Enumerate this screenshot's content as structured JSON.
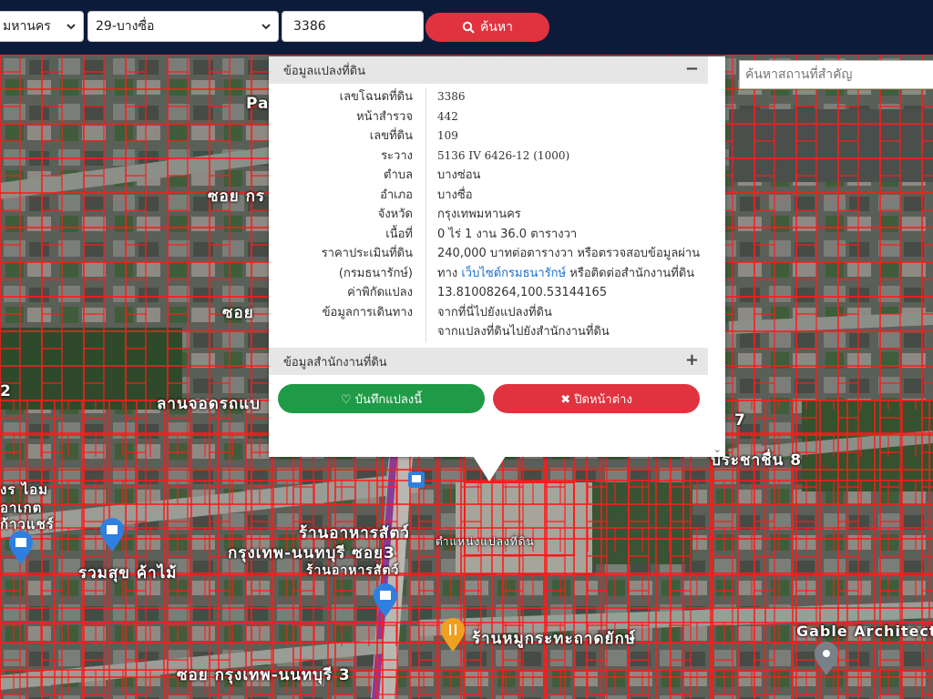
{
  "search": {
    "province_value": "มหานคร",
    "district_value": "29-บางซื่อ",
    "deed_value": "3386",
    "search_label": "ค้นหา"
  },
  "map": {
    "place_search_placeholder": "ค้นหาสถานที่สำคัญ",
    "labels": {
      "pa": "Pa",
      "soi_top": "ซอย กร",
      "soi_mid": "ซอย",
      "num2": "2",
      "lan_jod": "ลานจอดรถแบ",
      "num7": "7",
      "pracha_8": "ประชาชื่น 8",
      "left_text": "งร ไอม",
      "left_text2": "อาเกต",
      "left_text3": "ก้าวแชร์",
      "ruam_suk": "รวมสุข ค้าไม้",
      "restaurant": "ร้านอาหารสัตว์",
      "bkk_non_soi3": "กรุงเทพ-นนทบุรี ซอย3",
      "restaurant2": "ร้านอาหารสัตว์",
      "parcel_pos": "ตำแหน่งแปลงที่ดิน",
      "moo_kratha": "ร้านหมูกระทะถาดยักษ์",
      "gable": "Gable Architect",
      "soi_bottom": "ซอย กรุงเทพ-นนทบุรี 3"
    }
  },
  "popup": {
    "section1_title": "ข้อมูลแปลงที่ดิน",
    "section1_toggle": "−",
    "rows": [
      {
        "k": "เลขโฉนดที่ดิน",
        "v": "3386"
      },
      {
        "k": "หน้าสำรวจ",
        "v": "442"
      },
      {
        "k": "เลขที่ดิน",
        "v": "109"
      },
      {
        "k": "ระวาง",
        "v": "5136 IV 6426-12 (1000)"
      },
      {
        "k": "ตำบล",
        "v": "บางซ่อน"
      },
      {
        "k": "อำเภอ",
        "v": "บางซื่อ"
      },
      {
        "k": "จังหวัด",
        "v": "กรุงเทพมหานคร"
      },
      {
        "k": "เนื้อที่",
        "v": "0 ไร่ 1 งาน 36.0 ตารางวา"
      },
      {
        "k": "ราคาประเมินที่ดิน",
        "v": "240,000 บาทต่อตารางวา หรือตรวจสอบข้อมูลผ่าน"
      }
    ],
    "dept_key": "(กรมธนารักษ์)",
    "dept_v1": "ทาง",
    "dept_link": "เว็บไซต์กรมธนารักษ์",
    "dept_v2": "หรือติดต่อสำนักงานที่ดิน",
    "coord_key": "ค่าพิกัดแปลง",
    "coord_value": "13.81008264,100.53144165",
    "travel_key": "ข้อมูลการเดินทาง",
    "travel_link1": "จากที่นี่ไปยังแปลงที่ดิน",
    "travel_link2": "จากแปลงที่ดินไปยังสำนักงานที่ดิน",
    "section2_title": "ข้อมูลสำนักงานที่ดิน",
    "section2_toggle": "+",
    "save_label": "บันทึกแปลงนี้",
    "close_label": "ปิดหน้าต่าง"
  },
  "colors": {
    "topbar": "#0d1b3b",
    "search_button": "#e0333f",
    "save_button": "#1f9a46",
    "close_button": "#e0333f",
    "parcel_lines": "#ff1a1a",
    "link": "#1a6fd0"
  }
}
